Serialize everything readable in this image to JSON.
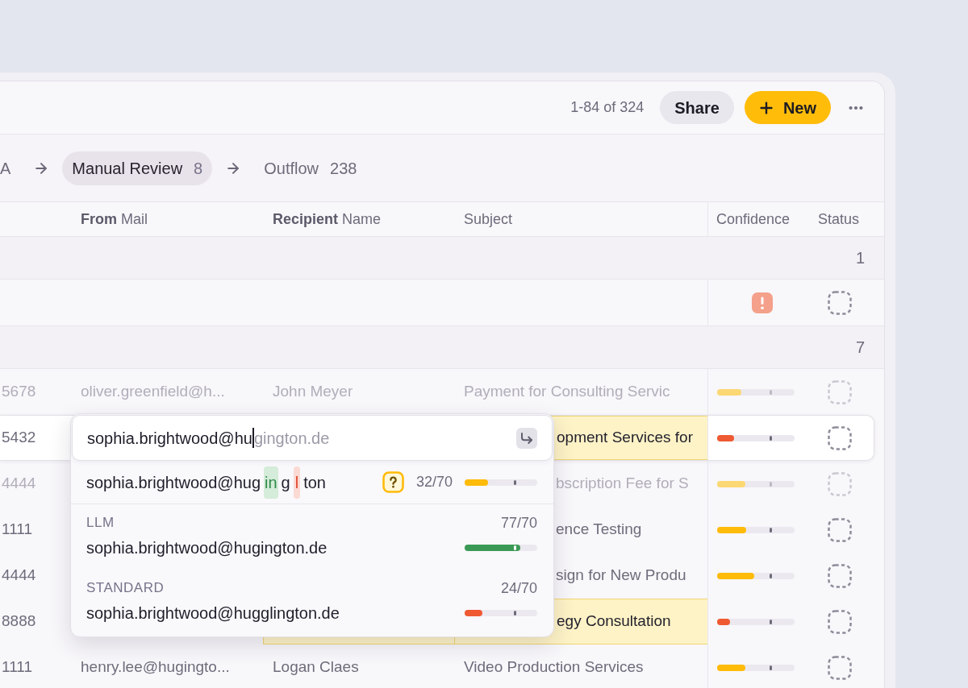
{
  "toolbar": {
    "range": "1-84 of 324",
    "share": "Share",
    "new": "New"
  },
  "pipeline": [
    {
      "label": "A",
      "selected": false
    },
    {
      "label": "Manual Review",
      "count": "8",
      "selected": true
    },
    {
      "label": "Outflow",
      "count": "238",
      "selected": false
    }
  ],
  "table": {
    "columns": [
      {
        "label": "**From** Mail"
      },
      {
        "label": "**Recipient** Name"
      },
      {
        "label": "Subject"
      },
      {
        "label": "Confidence"
      },
      {
        "label": "Status"
      }
    ],
    "groups": [
      {
        "count": "1",
        "rows": [
          {
            "selected": false,
            "dimmed": false,
            "recipient_flagged": false,
            "subject_flagged": false,
            "confidence": {
              "kind": "alert"
            }
          }
        ]
      },
      {
        "count": "7",
        "rows": [
          {
            "id": "5678",
            "from_mail": "oliver.greenfield@h...",
            "recipient_name": "John Meyer",
            "subject": "Payment for Consulting Servic",
            "selected": false,
            "dimmed": true,
            "under_popup": false,
            "recipient_flagged": false,
            "subject_flagged": false,
            "confidence": {
              "kind": "bar",
              "level": 0.31
            }
          },
          {
            "id": "5432",
            "subject": "opment Services for",
            "selected": true,
            "dimmed": false,
            "under_popup": true,
            "recipient_flagged": false,
            "subject_flagged": true,
            "confidence": {
              "kind": "bar",
              "level": 0.22
            }
          },
          {
            "id": "4444",
            "subject": "bscription Fee for S",
            "selected": false,
            "dimmed": true,
            "under_popup": true,
            "recipient_flagged": false,
            "subject_flagged": false,
            "confidence": {
              "kind": "bar",
              "level": 0.36
            }
          },
          {
            "id": "1111",
            "subject": "ence Testing",
            "selected": false,
            "dimmed": false,
            "under_popup": true,
            "recipient_flagged": false,
            "subject_flagged": false,
            "confidence": {
              "kind": "bar",
              "level": 0.37
            }
          },
          {
            "id": "4444",
            "subject": "sign for New Produ",
            "selected": false,
            "dimmed": false,
            "under_popup": true,
            "recipient_flagged": false,
            "subject_flagged": false,
            "confidence": {
              "kind": "bar",
              "level": 0.48
            }
          },
          {
            "id": "8888",
            "subject": "egy Consultation",
            "selected": false,
            "dimmed": false,
            "under_popup": true,
            "recipient_flagged": true,
            "subject_flagged": true,
            "confidence": {
              "kind": "bar",
              "level": 0.17
            }
          },
          {
            "id": "1111",
            "from_mail": "henry.lee@hugingto...",
            "recipient_name": "Logan Claes",
            "subject": "Video Production Services",
            "selected": false,
            "dimmed": false,
            "under_popup": false,
            "recipient_flagged": false,
            "subject_flagged": false,
            "confidence": {
              "kind": "bar",
              "level": 0.36
            }
          }
        ]
      }
    ]
  },
  "autocomplete": {
    "input": {
      "typed": "sophia.brightwood@hu",
      "suggestion": "gington.de"
    },
    "match": {
      "segments": [
        {
          "text": "sophia.brightwood@hug",
          "kind": "same"
        },
        {
          "text": "in",
          "kind": "added"
        },
        {
          "text": "g",
          "kind": "same"
        },
        {
          "text": "l",
          "kind": "removed"
        },
        {
          "text": "ton",
          "kind": "same"
        }
      ],
      "score": "32/70",
      "level": 0.32
    },
    "sources": [
      {
        "label": "LLM",
        "score": "77/70",
        "value": "sophia.brightwood@hugington.de",
        "level": 0.77
      },
      {
        "label": "STANDARD",
        "score": "24/70",
        "value": "sophia.brightwood@hugglington.de",
        "level": 0.24
      }
    ]
  }
}
